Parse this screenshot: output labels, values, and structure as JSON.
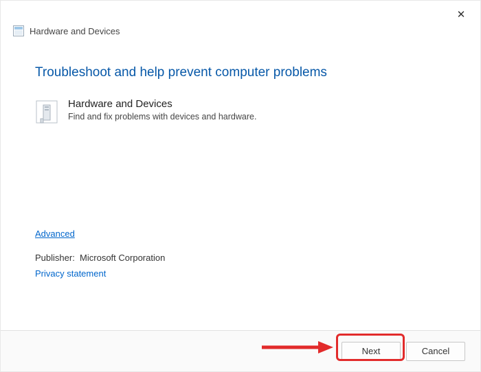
{
  "titlebar": {
    "close_char": "✕"
  },
  "header": {
    "title": "Hardware and Devices"
  },
  "main_heading": "Troubleshoot and help prevent computer problems",
  "troubleshooter": {
    "title": "Hardware and Devices",
    "subtitle": "Find and fix problems with devices and hardware."
  },
  "links": {
    "advanced": "Advanced",
    "privacy": "Privacy statement"
  },
  "publisher": {
    "label": "Publisher:",
    "value": "Microsoft Corporation"
  },
  "buttons": {
    "next": "Next",
    "cancel": "Cancel"
  }
}
